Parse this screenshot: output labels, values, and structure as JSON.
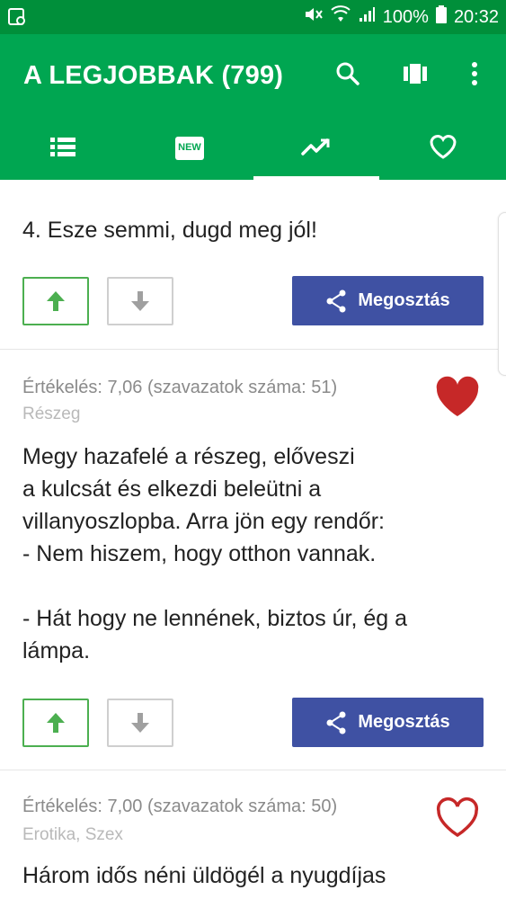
{
  "status_bar": {
    "battery_percent": "100%",
    "time": "20:32",
    "icons": [
      "screenshot-icon",
      "mute-icon",
      "wifi-icon",
      "signal-icon",
      "battery-icon"
    ]
  },
  "app_bar": {
    "title": "A LEGJOBBAK (799)",
    "actions": [
      "search-icon",
      "view-carousel-icon",
      "more-vert-icon"
    ]
  },
  "tabs": [
    {
      "icon": "list-icon",
      "selected": false
    },
    {
      "icon": "new-icon",
      "badge_text": "NEW",
      "selected": false
    },
    {
      "icon": "trending-icon",
      "selected": true
    },
    {
      "icon": "favorite-icon",
      "selected": false
    }
  ],
  "colors": {
    "status_bar": "#008f3a",
    "app_bar": "#00a651",
    "share_button": "#3f51a3",
    "upvote_border": "#4caf50",
    "heart_filled": "#c62828",
    "heart_outline": "#c62828"
  },
  "jokes": [
    {
      "text": "4. Esze semmi, dugd meg jól!",
      "share_label": "Megosztás"
    },
    {
      "rating": "Értékelés: 7,06 (szavazatok száma: 51)",
      "category": "Részeg",
      "favorited": true,
      "text": "Megy hazafelé a részeg, elővesziа kulcsát és elkezdi beleütni a villanyoszlopba. Arra jön egy rendőr:\n- Nem hiszem, hogy otthon vannak.\n\n- Hát hogy ne lennének, biztos úr, ég a lámpa.",
      "lines": [
        "Megy hazafelé a részeg, előveszi",
        "a kulcsát és elkezdi beleütni a",
        "villanyoszlopba. Arra jön egy rendőr:",
        "- Nem hiszem, hogy otthon vannak.",
        "",
        "- Hát hogy ne lennének, biztos úr, ég a",
        "lámpa."
      ],
      "share_label": "Megosztás"
    },
    {
      "rating": "Értékelés: 7,00 (szavazatok száma: 50)",
      "category": "Erotika, Szex",
      "favorited": false,
      "text": "Három idős néni üldögél a nyugdíjas"
    }
  ]
}
